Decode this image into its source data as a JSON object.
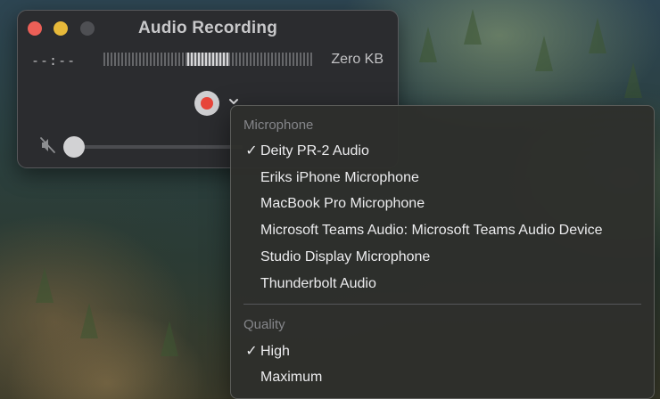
{
  "window": {
    "title": "Audio Recording",
    "time": "--:--",
    "file_size": "Zero KB"
  },
  "icons": {
    "record": "record-icon",
    "chevron": "chevron-down-icon",
    "mute": "speaker-muted-icon"
  },
  "volume_level": 0,
  "menu": {
    "microphone_header": "Microphone",
    "microphones": [
      {
        "label": "Deity PR-2 Audio",
        "checked": true
      },
      {
        "label": "Eriks iPhone Microphone",
        "checked": false
      },
      {
        "label": "MacBook Pro Microphone",
        "checked": false
      },
      {
        "label": "Microsoft Teams Audio: Microsoft Teams Audio Device",
        "checked": false
      },
      {
        "label": "Studio Display Microphone",
        "checked": false
      },
      {
        "label": "Thunderbolt Audio",
        "checked": false
      }
    ],
    "quality_header": "Quality",
    "qualities": [
      {
        "label": "High",
        "checked": true
      },
      {
        "label": "Maximum",
        "checked": false
      }
    ],
    "check_glyph": "✓"
  },
  "colors": {
    "record_red": "#e8463b",
    "close": "#ec5f57",
    "minimize": "#e7b93a"
  }
}
